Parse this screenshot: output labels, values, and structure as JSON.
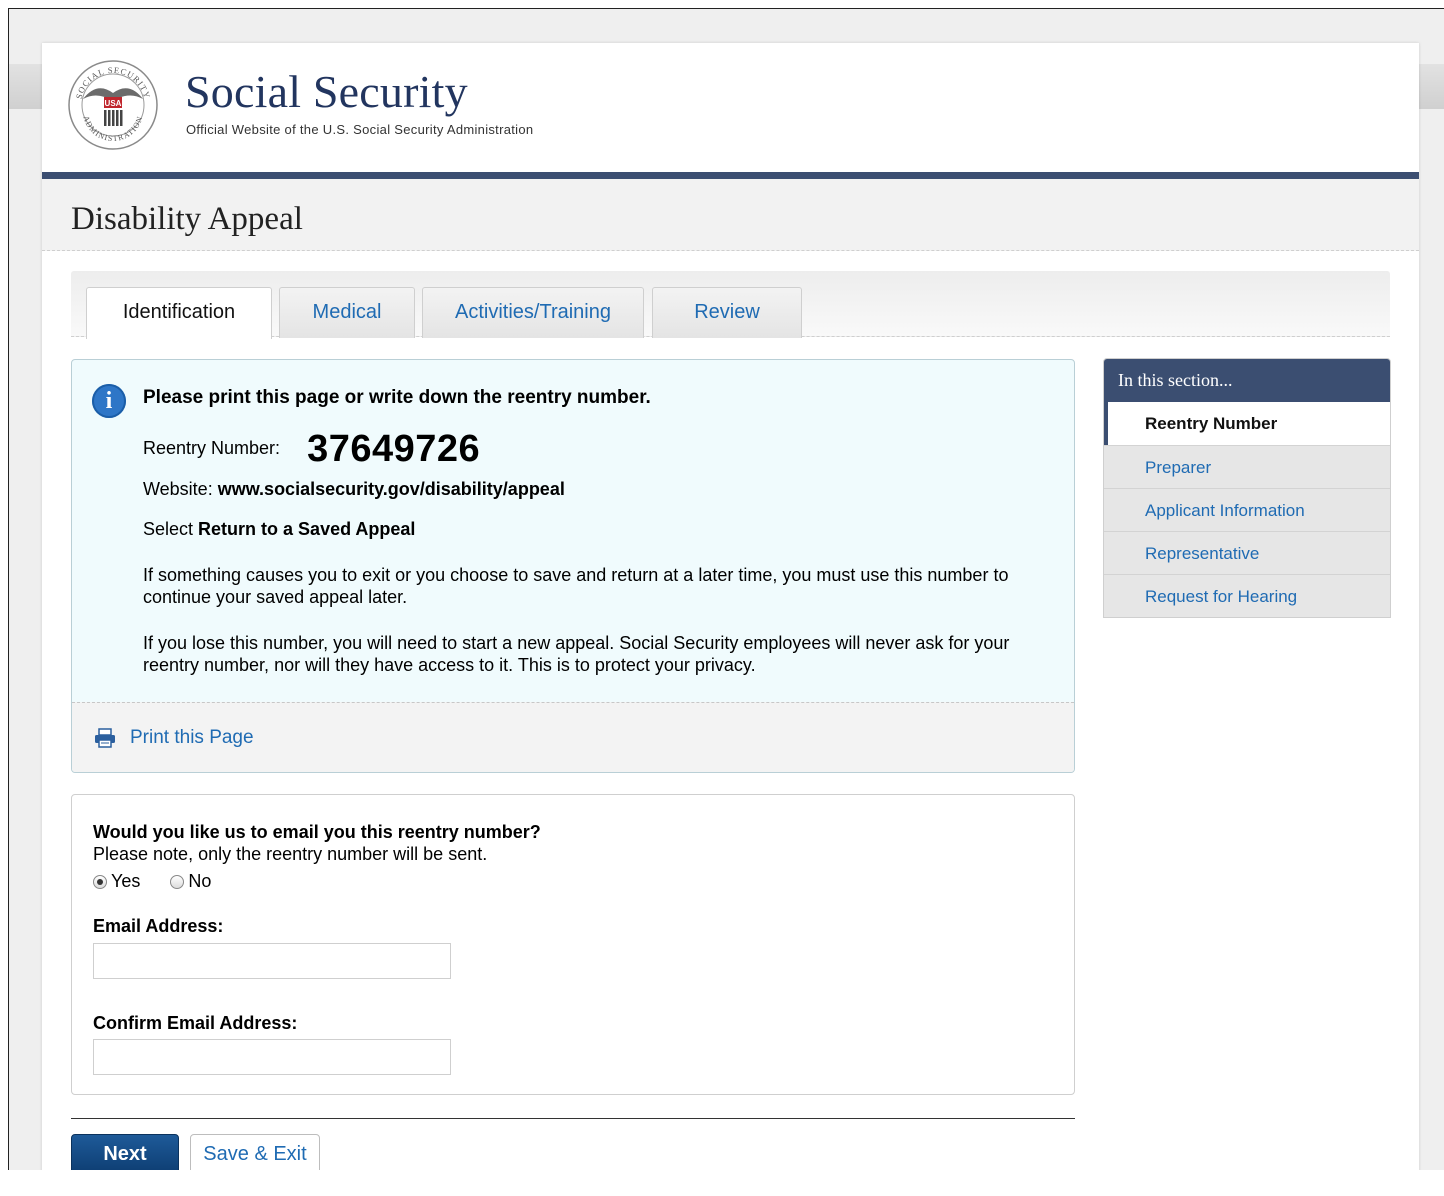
{
  "header": {
    "brand_title": "Social Security",
    "brand_subtitle": "Official Website of the U.S. Social Security Administration",
    "seal_text_top": "SOCIAL SECURITY",
    "seal_text_bottom": "ADMINISTRATION",
    "seal_badge": "USA"
  },
  "page_title": "Disability Appeal",
  "tabs": [
    {
      "label": "Identification",
      "active": true
    },
    {
      "label": "Medical",
      "active": false
    },
    {
      "label": "Activities/Training",
      "active": false
    },
    {
      "label": "Review",
      "active": false
    }
  ],
  "info": {
    "heading": "Please print this page or write down the reentry number.",
    "reentry_label": "Reentry Number:",
    "reentry_number": "37649726",
    "website_label": "Website:",
    "website_url": "www.socialsecurity.gov/disability/appeal",
    "select_label": "Select",
    "select_value": "Return to a Saved Appeal",
    "para1": "If something causes you to exit or you choose to save and return at a later time, you must use this number to continue your saved appeal later.",
    "para2": "If you lose this number, you will need to start a new appeal. Social Security employees will never ask for your reentry number, nor will they have access to it. This is to protect your privacy.",
    "print_link": "Print this Page"
  },
  "email": {
    "question": "Would you like us to email you this reentry number?",
    "note": "Please note, only the reentry number will be sent.",
    "yes_label": "Yes",
    "no_label": "No",
    "selected": "Yes",
    "email_label": "Email Address:",
    "email_value": "",
    "confirm_label": "Confirm Email Address:",
    "confirm_value": ""
  },
  "buttons": {
    "next": "Next",
    "save_exit": "Save & Exit"
  },
  "side_nav": {
    "heading": "In this section...",
    "items": [
      {
        "label": "Reentry Number",
        "active": true
      },
      {
        "label": "Preparer",
        "active": false
      },
      {
        "label": "Applicant Information",
        "active": false
      },
      {
        "label": "Representative",
        "active": false
      },
      {
        "label": "Request for Hearing",
        "active": false
      }
    ]
  },
  "colors": {
    "brand_navy": "#3b4e71",
    "link_blue": "#1f6bb3",
    "info_bg": "#f0fbfd",
    "next_button": "#0d3d72"
  }
}
